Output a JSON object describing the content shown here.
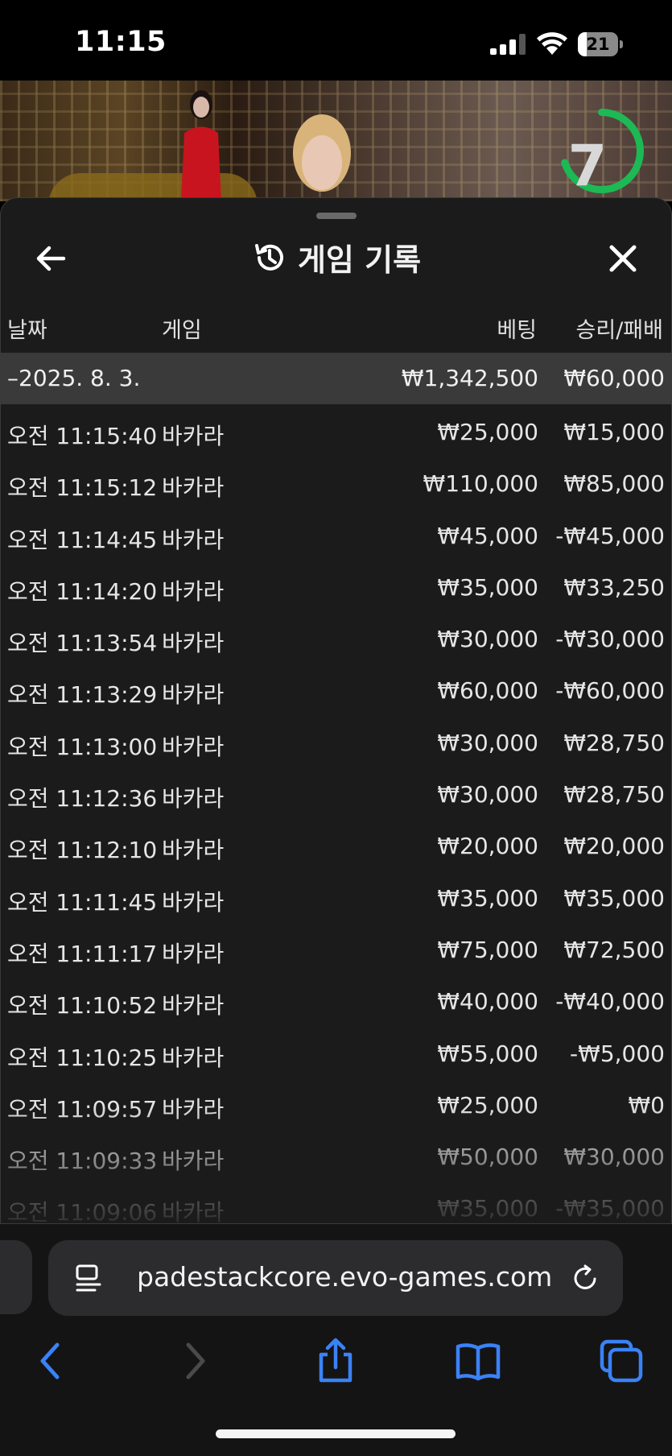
{
  "status_bar": {
    "time": "11:15",
    "battery": "21",
    "battery_level": 0.21
  },
  "video": {
    "timer_value": "7",
    "timer_fraction": 0.7,
    "timer_color": "#1db954"
  },
  "panel": {
    "title": "게임 기록",
    "columns": {
      "date": "날짜",
      "game": "게임",
      "bet": "베팅",
      "win_loss": "승리/패배"
    },
    "summary": {
      "date": "–2025. 8. 3.",
      "bet": "₩1,342,500",
      "win_loss": "₩60,000"
    },
    "rows": [
      {
        "time": "오전 11:15:40",
        "game": "바카라",
        "bet": "₩25,000",
        "win_loss": "₩15,000"
      },
      {
        "time": "오전 11:15:12",
        "game": "바카라",
        "bet": "₩110,000",
        "win_loss": "₩85,000"
      },
      {
        "time": "오전 11:14:45",
        "game": "바카라",
        "bet": "₩45,000",
        "win_loss": "-₩45,000"
      },
      {
        "time": "오전 11:14:20",
        "game": "바카라",
        "bet": "₩35,000",
        "win_loss": "₩33,250"
      },
      {
        "time": "오전 11:13:54",
        "game": "바카라",
        "bet": "₩30,000",
        "win_loss": "-₩30,000"
      },
      {
        "time": "오전 11:13:29",
        "game": "바카라",
        "bet": "₩60,000",
        "win_loss": "-₩60,000"
      },
      {
        "time": "오전 11:13:00",
        "game": "바카라",
        "bet": "₩30,000",
        "win_loss": "₩28,750"
      },
      {
        "time": "오전 11:12:36",
        "game": "바카라",
        "bet": "₩30,000",
        "win_loss": "₩28,750"
      },
      {
        "time": "오전 11:12:10",
        "game": "바카라",
        "bet": "₩20,000",
        "win_loss": "₩20,000"
      },
      {
        "time": "오전 11:11:45",
        "game": "바카라",
        "bet": "₩35,000",
        "win_loss": "₩35,000"
      },
      {
        "time": "오전 11:11:17",
        "game": "바카라",
        "bet": "₩75,000",
        "win_loss": "₩72,500"
      },
      {
        "time": "오전 11:10:52",
        "game": "바카라",
        "bet": "₩40,000",
        "win_loss": "-₩40,000"
      },
      {
        "time": "오전 11:10:25",
        "game": "바카라",
        "bet": "₩55,000",
        "win_loss": "-₩5,000"
      },
      {
        "time": "오전 11:09:57",
        "game": "바카라",
        "bet": "₩25,000",
        "win_loss": "₩0"
      },
      {
        "time": "오전 11:09:33",
        "game": "바카라",
        "bet": "₩50,000",
        "win_loss": "₩30,000"
      },
      {
        "time": "오전 11:09:06",
        "game": "바카라",
        "bet": "₩35,000",
        "win_loss": "-₩35,000"
      }
    ]
  },
  "browser": {
    "url": "padestackcore.evo-games.com",
    "accent": "#3a82f7"
  }
}
